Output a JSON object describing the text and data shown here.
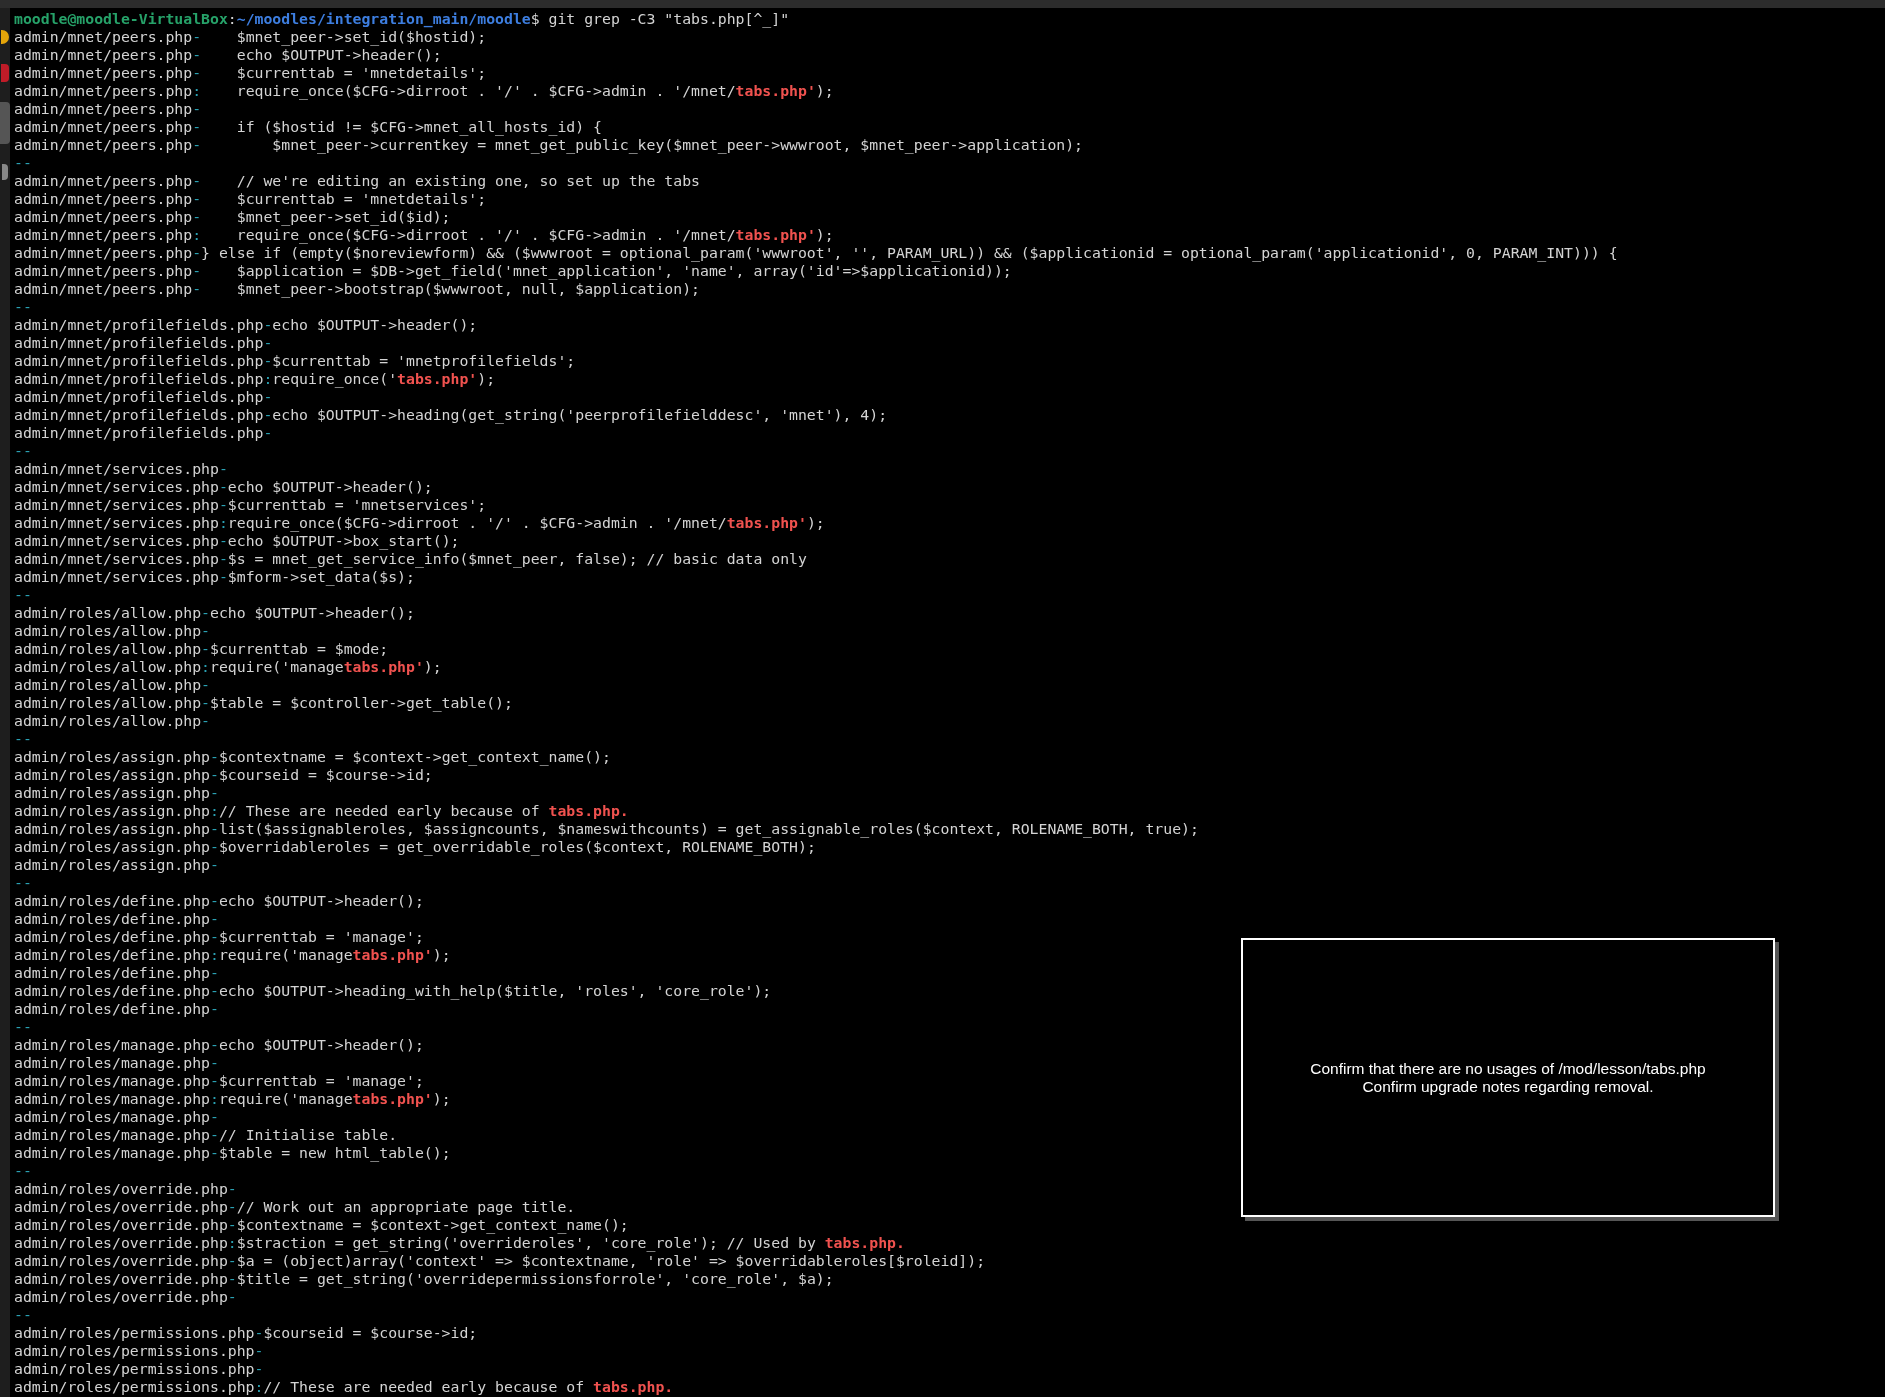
{
  "prompt": {
    "user_host": "moodle@moodle-VirtualBox",
    "colon": ":",
    "path": "~/moodles/integration_main/moodle",
    "command": "$ git grep -C3 \"tabs.php[^_]\""
  },
  "lines": [
    {
      "kind": "context",
      "file": "admin/mnet/peers.php",
      "sep": "-",
      "code": "    $mnet_peer->set_id($hostid);"
    },
    {
      "kind": "context",
      "file": "admin/mnet/peers.php",
      "sep": "-",
      "code": "    echo $OUTPUT->header();"
    },
    {
      "kind": "context",
      "file": "admin/mnet/peers.php",
      "sep": "-",
      "code": "    $currenttab = 'mnetdetails';"
    },
    {
      "kind": "match",
      "file": "admin/mnet/peers.php",
      "sep": ":",
      "code": "    require_once($CFG->dirroot . '/' . $CFG->admin . '/mnet/**tabs.php'**);"
    },
    {
      "kind": "context",
      "file": "admin/mnet/peers.php",
      "sep": "-"
    },
    {
      "kind": "context",
      "file": "admin/mnet/peers.php",
      "sep": "-",
      "code": "    if ($hostid != $CFG->mnet_all_hosts_id) {"
    },
    {
      "kind": "context",
      "file": "admin/mnet/peers.php",
      "sep": "-",
      "code": "        $mnet_peer->currentkey = mnet_get_public_key($mnet_peer->wwwroot, $mnet_peer->application);"
    },
    {
      "kind": "break",
      "text": "--"
    },
    {
      "kind": "context",
      "file": "admin/mnet/peers.php",
      "sep": "-",
      "code": "    // we're editing an existing one, so set up the tabs"
    },
    {
      "kind": "context",
      "file": "admin/mnet/peers.php",
      "sep": "-",
      "code": "    $currenttab = 'mnetdetails';"
    },
    {
      "kind": "context",
      "file": "admin/mnet/peers.php",
      "sep": "-",
      "code": "    $mnet_peer->set_id($id);"
    },
    {
      "kind": "match",
      "file": "admin/mnet/peers.php",
      "sep": ":",
      "code": "    require_once($CFG->dirroot . '/' . $CFG->admin . '/mnet/**tabs.php'**);"
    },
    {
      "kind": "context",
      "file": "admin/mnet/peers.php",
      "sep": "-",
      "code": "} else if (empty($noreviewform) && ($wwwroot = optional_param('wwwroot', '', PARAM_URL)) && ($applicationid = optional_param('applicationid', 0, PARAM_INT))) {"
    },
    {
      "kind": "context",
      "file": "admin/mnet/peers.php",
      "sep": "-",
      "code": "    $application = $DB->get_field('mnet_application', 'name', array('id'=>$applicationid));"
    },
    {
      "kind": "context",
      "file": "admin/mnet/peers.php",
      "sep": "-",
      "code": "    $mnet_peer->bootstrap($wwwroot, null, $application);"
    },
    {
      "kind": "break",
      "text": "--"
    },
    {
      "kind": "context",
      "file": "admin/mnet/profilefields.php",
      "sep": "-",
      "code": "echo $OUTPUT->header();"
    },
    {
      "kind": "context",
      "file": "admin/mnet/profilefields.php",
      "sep": "-"
    },
    {
      "kind": "context",
      "file": "admin/mnet/profilefields.php",
      "sep": "-",
      "code": "$currenttab = 'mnetprofilefields';"
    },
    {
      "kind": "match",
      "file": "admin/mnet/profilefields.php",
      "sep": ":",
      "code": "require_once('**tabs.php'**);"
    },
    {
      "kind": "context",
      "file": "admin/mnet/profilefields.php",
      "sep": "-"
    },
    {
      "kind": "context",
      "file": "admin/mnet/profilefields.php",
      "sep": "-",
      "code": "echo $OUTPUT->heading(get_string('peerprofilefielddesc', 'mnet'), 4);"
    },
    {
      "kind": "context",
      "file": "admin/mnet/profilefields.php",
      "sep": "-"
    },
    {
      "kind": "break",
      "text": "--"
    },
    {
      "kind": "context",
      "file": "admin/mnet/services.php",
      "sep": "-"
    },
    {
      "kind": "context",
      "file": "admin/mnet/services.php",
      "sep": "-",
      "code": "echo $OUTPUT->header();"
    },
    {
      "kind": "context",
      "file": "admin/mnet/services.php",
      "sep": "-",
      "code": "$currenttab = 'mnetservices';"
    },
    {
      "kind": "match",
      "file": "admin/mnet/services.php",
      "sep": ":",
      "code": "require_once($CFG->dirroot . '/' . $CFG->admin . '/mnet/**tabs.php'**);"
    },
    {
      "kind": "context",
      "file": "admin/mnet/services.php",
      "sep": "-",
      "code": "echo $OUTPUT->box_start();"
    },
    {
      "kind": "context",
      "file": "admin/mnet/services.php",
      "sep": "-",
      "code": "$s = mnet_get_service_info($mnet_peer, false); // basic data only"
    },
    {
      "kind": "context",
      "file": "admin/mnet/services.php",
      "sep": "-",
      "code": "$mform->set_data($s);"
    },
    {
      "kind": "break",
      "text": "--"
    },
    {
      "kind": "context",
      "file": "admin/roles/allow.php",
      "sep": "-",
      "code": "echo $OUTPUT->header();"
    },
    {
      "kind": "context",
      "file": "admin/roles/allow.php",
      "sep": "-"
    },
    {
      "kind": "context",
      "file": "admin/roles/allow.php",
      "sep": "-",
      "code": "$currenttab = $mode;"
    },
    {
      "kind": "match",
      "file": "admin/roles/allow.php",
      "sep": ":",
      "code": "require('manage**tabs.php'**);"
    },
    {
      "kind": "context",
      "file": "admin/roles/allow.php",
      "sep": "-"
    },
    {
      "kind": "context",
      "file": "admin/roles/allow.php",
      "sep": "-",
      "code": "$table = $controller->get_table();"
    },
    {
      "kind": "context",
      "file": "admin/roles/allow.php",
      "sep": "-"
    },
    {
      "kind": "break",
      "text": "--"
    },
    {
      "kind": "context",
      "file": "admin/roles/assign.php",
      "sep": "-",
      "code": "$contextname = $context->get_context_name();"
    },
    {
      "kind": "context",
      "file": "admin/roles/assign.php",
      "sep": "-",
      "code": "$courseid = $course->id;"
    },
    {
      "kind": "context",
      "file": "admin/roles/assign.php",
      "sep": "-"
    },
    {
      "kind": "match",
      "file": "admin/roles/assign.php",
      "sep": ":",
      "code": "// These are needed early because of **tabs.php.**"
    },
    {
      "kind": "context",
      "file": "admin/roles/assign.php",
      "sep": "-",
      "code": "list($assignableroles, $assigncounts, $nameswithcounts) = get_assignable_roles($context, ROLENAME_BOTH, true);"
    },
    {
      "kind": "context",
      "file": "admin/roles/assign.php",
      "sep": "-",
      "code": "$overridableroles = get_overridable_roles($context, ROLENAME_BOTH);"
    },
    {
      "kind": "context",
      "file": "admin/roles/assign.php",
      "sep": "-"
    },
    {
      "kind": "break",
      "text": "--"
    },
    {
      "kind": "context",
      "file": "admin/roles/define.php",
      "sep": "-",
      "code": "echo $OUTPUT->header();"
    },
    {
      "kind": "context",
      "file": "admin/roles/define.php",
      "sep": "-"
    },
    {
      "kind": "context",
      "file": "admin/roles/define.php",
      "sep": "-",
      "code": "$currenttab = 'manage';"
    },
    {
      "kind": "match",
      "file": "admin/roles/define.php",
      "sep": ":",
      "code": "require('manage**tabs.php'**);"
    },
    {
      "kind": "context",
      "file": "admin/roles/define.php",
      "sep": "-"
    },
    {
      "kind": "context",
      "file": "admin/roles/define.php",
      "sep": "-",
      "code": "echo $OUTPUT->heading_with_help($title, 'roles', 'core_role');"
    },
    {
      "kind": "context",
      "file": "admin/roles/define.php",
      "sep": "-"
    },
    {
      "kind": "break",
      "text": "--"
    },
    {
      "kind": "context",
      "file": "admin/roles/manage.php",
      "sep": "-",
      "code": "echo $OUTPUT->header();"
    },
    {
      "kind": "context",
      "file": "admin/roles/manage.php",
      "sep": "-"
    },
    {
      "kind": "context",
      "file": "admin/roles/manage.php",
      "sep": "-",
      "code": "$currenttab = 'manage';"
    },
    {
      "kind": "match",
      "file": "admin/roles/manage.php",
      "sep": ":",
      "code": "require('manage**tabs.php'**);"
    },
    {
      "kind": "context",
      "file": "admin/roles/manage.php",
      "sep": "-"
    },
    {
      "kind": "context",
      "file": "admin/roles/manage.php",
      "sep": "-",
      "code": "// Initialise table."
    },
    {
      "kind": "context",
      "file": "admin/roles/manage.php",
      "sep": "-",
      "code": "$table = new html_table();"
    },
    {
      "kind": "break",
      "text": "--"
    },
    {
      "kind": "context",
      "file": "admin/roles/override.php",
      "sep": "-"
    },
    {
      "kind": "context",
      "file": "admin/roles/override.php",
      "sep": "-",
      "code": "// Work out an appropriate page title."
    },
    {
      "kind": "context",
      "file": "admin/roles/override.php",
      "sep": "-",
      "code": "$contextname = $context->get_context_name();"
    },
    {
      "kind": "match",
      "file": "admin/roles/override.php",
      "sep": ":",
      "code": "$straction = get_string('overrideroles', 'core_role'); // Used by **tabs.php.**"
    },
    {
      "kind": "context",
      "file": "admin/roles/override.php",
      "sep": "-",
      "code": "$a = (object)array('context' => $contextname, 'role' => $overridableroles[$roleid]);"
    },
    {
      "kind": "context",
      "file": "admin/roles/override.php",
      "sep": "-",
      "code": "$title = get_string('overridepermissionsforrole', 'core_role', $a);"
    },
    {
      "kind": "context",
      "file": "admin/roles/override.php",
      "sep": "-"
    },
    {
      "kind": "break",
      "text": "--"
    },
    {
      "kind": "context",
      "file": "admin/roles/permissions.php",
      "sep": "-",
      "code": "$courseid = $course->id;"
    },
    {
      "kind": "context",
      "file": "admin/roles/permissions.php",
      "sep": "-"
    },
    {
      "kind": "context",
      "file": "admin/roles/permissions.php",
      "sep": "-"
    },
    {
      "kind": "match",
      "file": "admin/roles/permissions.php",
      "sep": ":",
      "code": "// These are needed early because of **tabs.php.**"
    }
  ],
  "note": {
    "lines": [
      "Confirm that there are no usages of /mod/lesson/tabs.php",
      "Confirm upgrade notes regarding removal."
    ]
  }
}
